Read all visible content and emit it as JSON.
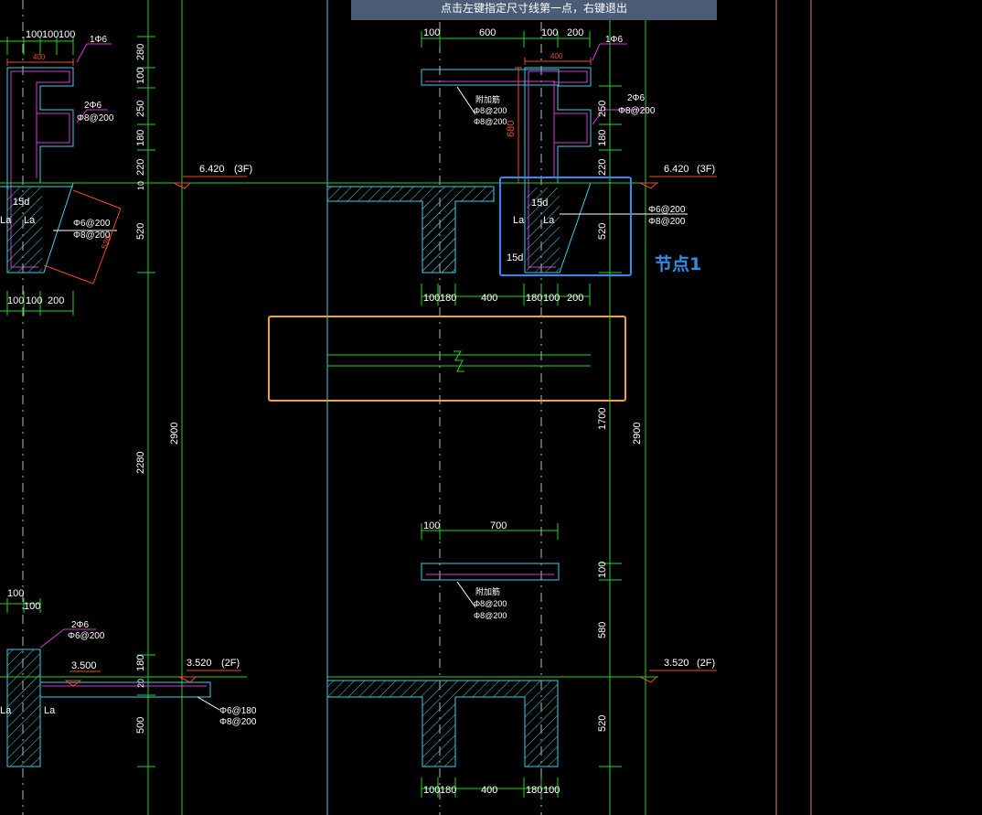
{
  "statusbar": {
    "prompt": "点击左键指定尺寸线第一点，右键退出"
  },
  "annotations": {
    "node_label": "节点1"
  },
  "colors": {
    "background": "#000000",
    "dim": "#25d425",
    "outline": "#3ad1e8",
    "rebar": "#d838d8",
    "red": "#f04a2a",
    "white": "#ffffff",
    "highlight_blue": "#2a8ff0",
    "highlight_yellow": "#f0a81a"
  },
  "drawing": {
    "top_left": {
      "dims_top": [
        "100",
        "100",
        "100"
      ],
      "rebar_top": "1Φ6",
      "red_dim": "400",
      "rebar_mid": [
        "2Φ6",
        "Φ8@200"
      ],
      "label_15d": "15d",
      "label_la": [
        "La",
        "La"
      ],
      "slab_rebar": [
        "Φ6@200",
        "Φ8@200"
      ],
      "red_diag": "520",
      "dims_bottom": [
        "100",
        "100",
        "200"
      ]
    },
    "left_vertical_dims": [
      "280",
      "100",
      "250",
      "180",
      "220",
      "10",
      "520",
      "2280",
      "2900"
    ],
    "level_3f": {
      "value": "6.420",
      "floor": "(3F)"
    },
    "top_center": {
      "dims_top": [
        "100",
        "600",
        "100",
        "200"
      ],
      "rebar_top": "1Φ6",
      "red_dim": "400",
      "rebar_note": [
        "附加筋",
        "Φ8@200",
        "Φ8@200"
      ],
      "red_vert": "680",
      "rebar_mid": [
        "2Φ6",
        "Φ8@200"
      ],
      "label_15d": [
        "15d",
        "15d"
      ],
      "label_la": [
        "La",
        "La"
      ],
      "slab_rebar": [
        "Φ6@200",
        "Φ8@200"
      ],
      "dims_bottom": [
        "100",
        "180",
        "400",
        "180",
        "100",
        "200"
      ]
    },
    "right_vertical_dims": [
      "250",
      "180",
      "220",
      "520",
      "1700",
      "2900",
      "100",
      "580",
      "520"
    ],
    "middle_beam": {
      "dims_top": [
        "100",
        "700"
      ],
      "rebar_note": [
        "附加筋",
        "Φ8@200",
        "Φ8@200"
      ]
    },
    "bottom_left": {
      "dims_top": [
        "100",
        "100"
      ],
      "rebar": [
        "2Φ6",
        "Φ6@200"
      ],
      "level": "3.500",
      "level_2f": {
        "value": "3.520",
        "floor": "(2F)"
      },
      "label_la": [
        "La",
        "La"
      ],
      "slab_rebar": [
        "Φ6@180",
        "Φ8@200"
      ],
      "vdims": [
        "180",
        "20",
        "500"
      ]
    },
    "level_2f": {
      "value": "3.520",
      "floor": "(2F)"
    },
    "bottom_center": {
      "dims_bottom": [
        "100",
        "180",
        "400",
        "180",
        "100"
      ]
    }
  }
}
